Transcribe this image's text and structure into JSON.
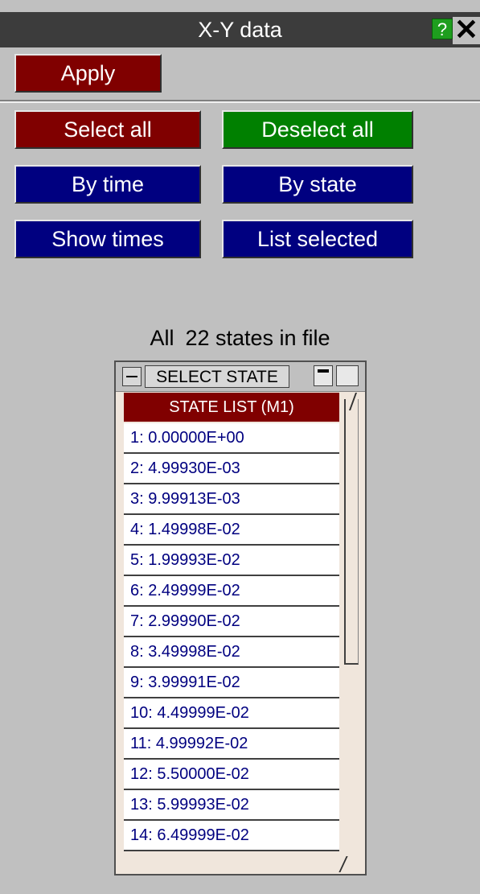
{
  "window": {
    "title": "X-Y data",
    "help_label": "?",
    "close_label": "✕"
  },
  "toolbar": {
    "apply_label": "Apply"
  },
  "actions": {
    "select_all": "Select all",
    "deselect_all": "Deselect all",
    "by_time": "By time",
    "by_state": "By state",
    "show_times": "Show times",
    "list_selected": "List selected"
  },
  "info": {
    "scope": "All",
    "count_text": "22 states in file"
  },
  "state_list": {
    "window_title": "SELECT STATE",
    "header": "STATE LIST (M1)",
    "items": [
      "1:  0.00000E+00",
      "2:  4.99930E-03",
      "3:  9.99913E-03",
      "4:  1.49998E-02",
      "5:  1.99993E-02",
      "6:  2.49999E-02",
      "7:  2.99990E-02",
      "8:  3.49998E-02",
      "9:  3.99991E-02",
      "10:  4.49999E-02",
      "11:  4.99992E-02",
      "12:  5.50000E-02",
      "13:  5.99993E-02",
      "14:  6.49999E-02"
    ]
  },
  "colors": {
    "panel": "#c0c0c0",
    "titlebar": "#3c3c3c",
    "red_button": "#800000",
    "green_button": "#008000",
    "blue_button": "#000080",
    "list_text": "#000080"
  }
}
